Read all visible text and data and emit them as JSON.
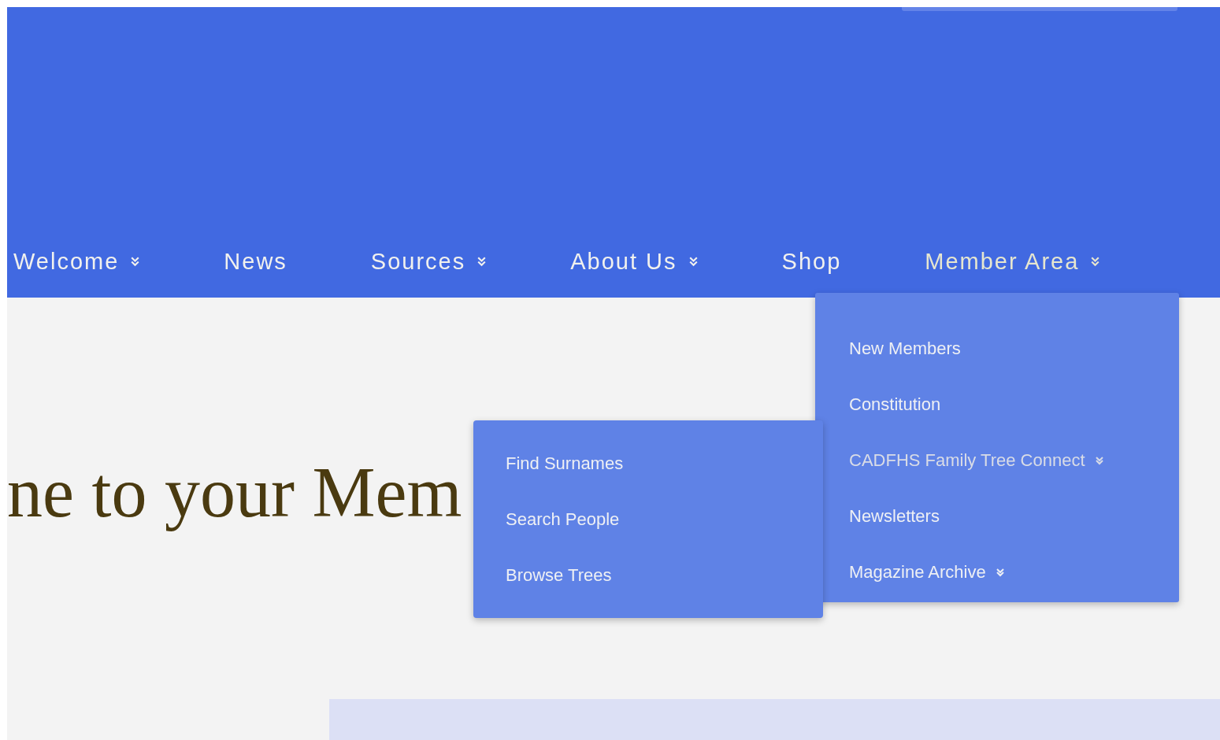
{
  "nav": [
    {
      "label": "Welcome",
      "dropdown": true,
      "open": false
    },
    {
      "label": "News",
      "dropdown": false,
      "open": false
    },
    {
      "label": "Sources",
      "dropdown": true,
      "open": false
    },
    {
      "label": "About Us",
      "dropdown": true,
      "open": false
    },
    {
      "label": "Shop",
      "dropdown": false,
      "open": false
    },
    {
      "label": "Member Area",
      "dropdown": true,
      "open": true,
      "items": [
        {
          "label": "New Members",
          "submenu": false
        },
        {
          "label": "Constitution",
          "submenu": false
        },
        {
          "label": "CADFHS Family Tree Connect",
          "submenu": true,
          "expanded": true,
          "children": [
            {
              "label": "Find Surnames"
            },
            {
              "label": "Search People"
            },
            {
              "label": "Browse Trees"
            }
          ]
        },
        {
          "label": "Newsletters",
          "submenu": false
        },
        {
          "label": "Magazine Archive",
          "submenu": true,
          "expanded": false
        }
      ]
    }
  ],
  "heading": "ne to your Mem"
}
